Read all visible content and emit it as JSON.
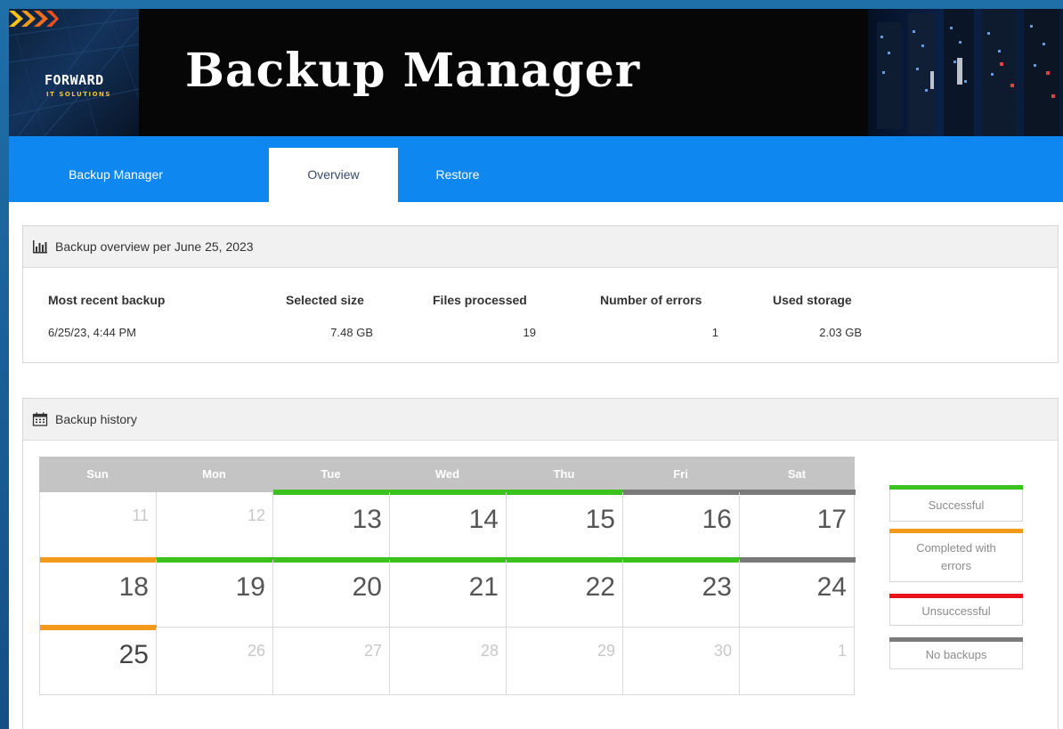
{
  "banner": {
    "title": "Backup Manager",
    "logo_word": "FORWARD",
    "logo_sub": "IT SOLUTIONS"
  },
  "nav": {
    "tabs": [
      {
        "label": "Backup Manager"
      },
      {
        "label": "Overview",
        "active": true
      },
      {
        "label": "Restore"
      }
    ]
  },
  "overview": {
    "title": "Backup overview per June 25, 2023",
    "stats": [
      {
        "label": "Most recent backup",
        "value": "6/25/23, 4:44 PM"
      },
      {
        "label": "Selected size",
        "value": "7.48 GB"
      },
      {
        "label": "Files processed",
        "value": "19"
      },
      {
        "label": "Number of errors",
        "value": "1"
      },
      {
        "label": "Used storage",
        "value": "2.03 GB"
      }
    ]
  },
  "history": {
    "title": "Backup history",
    "days": [
      "Sun",
      "Mon",
      "Tue",
      "Wed",
      "Thu",
      "Fri",
      "Sat"
    ],
    "weeks": [
      [
        "11",
        "12",
        "13",
        "14",
        "15",
        "16",
        "17"
      ],
      [
        "18",
        "19",
        "20",
        "21",
        "22",
        "23",
        "24"
      ],
      [
        "25",
        "26",
        "27",
        "28",
        "29",
        "30",
        "1"
      ]
    ],
    "statuses": [
      [
        "none",
        "none",
        "successful",
        "successful",
        "successful",
        "no-backups",
        "no-backups"
      ],
      [
        "errors",
        "successful",
        "successful",
        "successful",
        "successful",
        "successful",
        "no-backups"
      ],
      [
        "errors",
        "none",
        "none",
        "none",
        "none",
        "none",
        "none"
      ]
    ],
    "legend": {
      "successful": "Successful",
      "errors": "Completed with errors",
      "unsuccessful": "Unsuccessful",
      "no_backups": "No backups"
    }
  },
  "colors": {
    "nav": "#0f87f0",
    "successful": "#3cc21f",
    "errors": "#f39a1c",
    "unsuccessful": "#e8121b",
    "no_backups": "#7a7a7a"
  }
}
